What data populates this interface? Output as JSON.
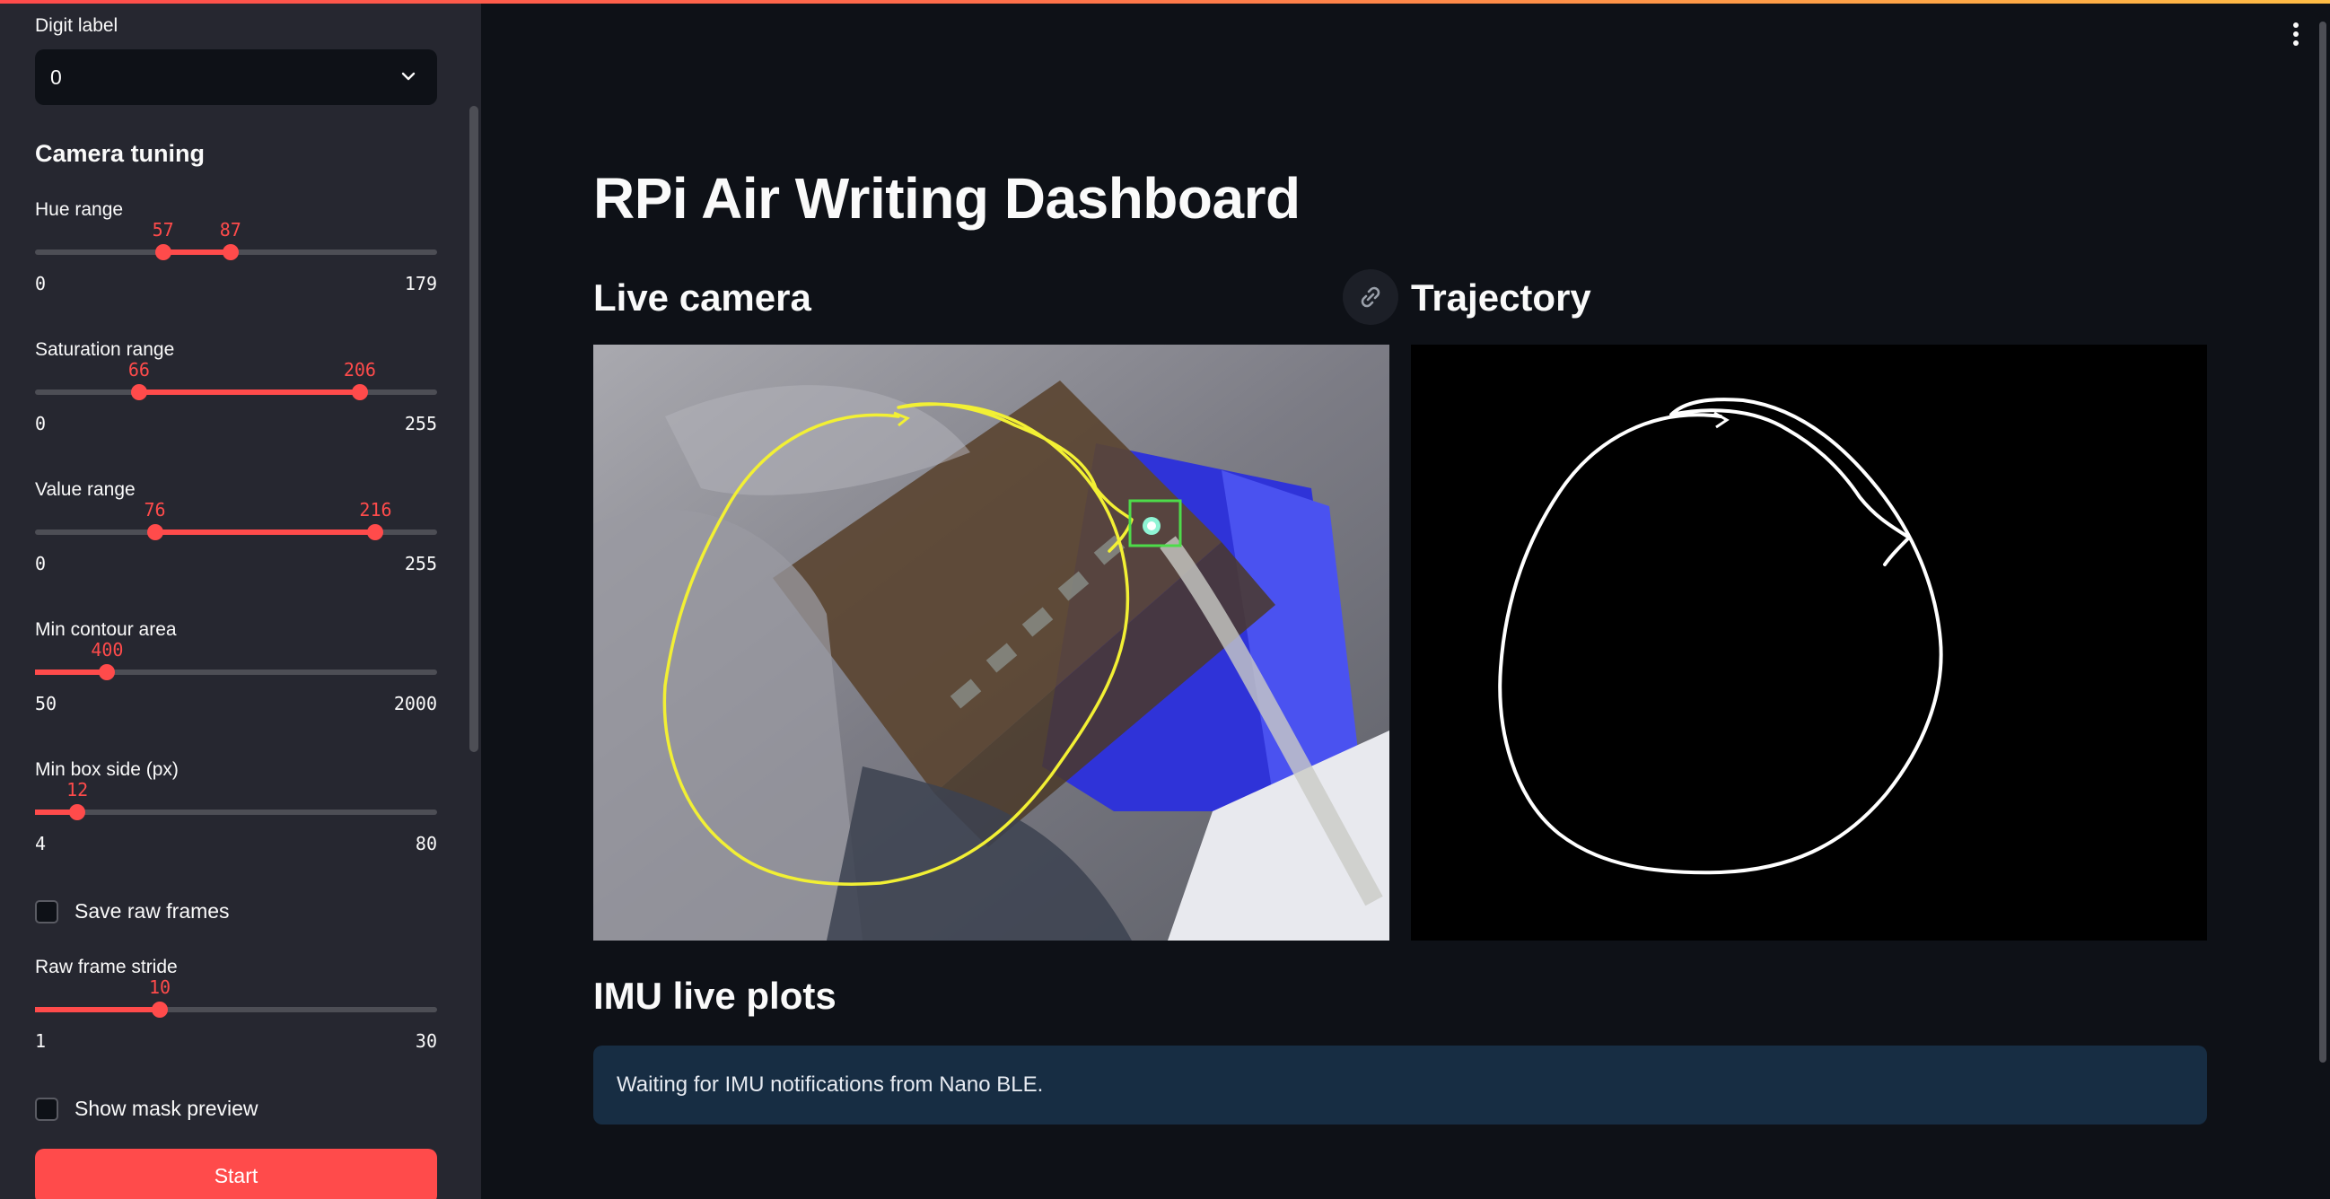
{
  "sidebar": {
    "digit_label": {
      "label": "Digit label",
      "value": "0"
    },
    "camera_tuning_title": "Camera tuning",
    "sliders": [
      {
        "name": "Hue range",
        "min": "0",
        "max": "179",
        "lo": "57",
        "hi": "87",
        "range": [
          0,
          179
        ],
        "values": [
          57,
          87
        ]
      },
      {
        "name": "Saturation range",
        "min": "0",
        "max": "255",
        "lo": "66",
        "hi": "206",
        "range": [
          0,
          255
        ],
        "values": [
          66,
          206
        ]
      },
      {
        "name": "Value range",
        "min": "0",
        "max": "255",
        "lo": "76",
        "hi": "216",
        "range": [
          0,
          255
        ],
        "values": [
          76,
          216
        ]
      },
      {
        "name": "Min contour area",
        "min": "50",
        "max": "2000",
        "lo": "400",
        "range": [
          50,
          2000
        ],
        "values": [
          400
        ]
      },
      {
        "name": "Min box side (px)",
        "min": "4",
        "max": "80",
        "lo": "12",
        "range": [
          4,
          80
        ],
        "values": [
          12
        ]
      }
    ],
    "save_raw_frames": {
      "label": "Save raw frames",
      "checked": false
    },
    "raw_frame_stride": {
      "name": "Raw frame stride",
      "min": "1",
      "max": "30",
      "lo": "10",
      "range": [
        1,
        30
      ],
      "values": [
        10
      ]
    },
    "show_mask_preview": {
      "label": "Show mask preview",
      "checked": false
    },
    "start_label": "Start"
  },
  "main": {
    "title": "RPi Air Writing Dashboard",
    "live_camera_title": "Live camera",
    "trajectory_title": "Trajectory",
    "imu_title": "IMU live plots",
    "imu_info": "Waiting for IMU notifications from Nano BLE."
  },
  "colors": {
    "accent": "#ff4b4b",
    "background": "#0e1117",
    "sidebar": "#262730",
    "info_box": "#172d43"
  }
}
